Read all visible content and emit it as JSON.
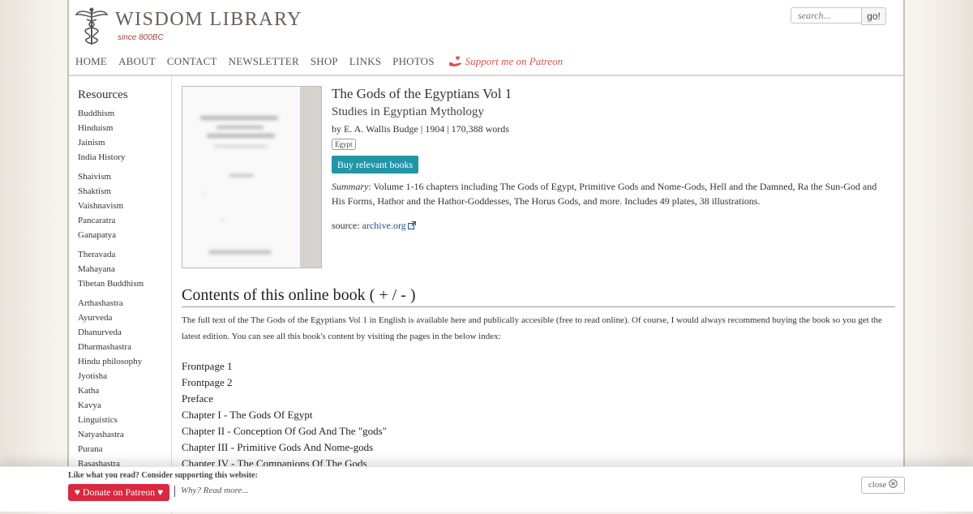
{
  "header": {
    "site_title": "WISDOM LIBRARY",
    "tagline": "since 800BC",
    "search_placeholder": "search...",
    "search_button": "go!"
  },
  "nav": {
    "items": [
      "HOME",
      "ABOUT",
      "CONTACT",
      "NEWSLETTER",
      "SHOP",
      "LINKS",
      "PHOTOS"
    ],
    "patreon_label": "Support me on Patreon"
  },
  "sidebar": {
    "heading": "Resources",
    "groups": [
      [
        "Buddhism",
        "Hinduism",
        "Jainism",
        "India History"
      ],
      [
        "Shaivism",
        "Shaktism",
        "Vaishnavism",
        "Pancaratra",
        "Ganapatya"
      ],
      [
        "Theravada",
        "Mahayana",
        "Tibetan Buddhism"
      ],
      [
        "Arthashastra",
        "Ayurveda",
        "Dhanurveda",
        "Dharmashastra",
        "Hindu philosophy",
        "Jyotisha",
        "Katha",
        "Kavya",
        "Linguistics",
        "Natyashastra",
        "Purana",
        "Rasashastra"
      ]
    ]
  },
  "book": {
    "title": "The Gods of the Egyptians Vol 1",
    "subtitle": "Studies in Egyptian Mythology",
    "meta": "by E. A. Wallis Budge | 1904 | 170,388 words",
    "tag": "Egypt",
    "buy_label": "Buy relevant books",
    "summary_label": "Summary",
    "summary_text": ": Volume 1-16 chapters including The Gods of Egypt, Primitive Gods and Nome-Gods, Hell and the Damned, Ra the Sun-God and His Forms, Hathor and the Hathor-Goddesses, The Horus Gods, and more. Includes 49 plates, 38 illustrations.",
    "source_label": "source: ",
    "source_link": "archive.org"
  },
  "contents": {
    "title": "Contents of this online book ( + / - )",
    "intro": "The full text of the The Gods of the Egyptians Vol 1 in English is available here and publically accesible (free to read online). Of course, I would always recommend buying the book so you get the latest edition. You can see all this book's content by visiting the pages in the below index:",
    "toc": [
      "Frontpage 1",
      "Frontpage 2",
      "Preface",
      "Chapter I - The Gods Of Egypt",
      "Chapter II - Conception Of God And The \"gods\"",
      "Chapter III - Primitive Gods And Nome-gods",
      "Chapter IV - The Companions Of The Gods"
    ]
  },
  "banner": {
    "text": "Like what you read? Consider supporting this website:",
    "donate_label": "♥ Donate on Patreon ♥",
    "why_label": "Why? Read more...",
    "close_label": "close"
  },
  "colors": {
    "accent_teal": "#2196a8",
    "patreon_red": "#d9283f",
    "link_blue": "#1c4f8a"
  }
}
